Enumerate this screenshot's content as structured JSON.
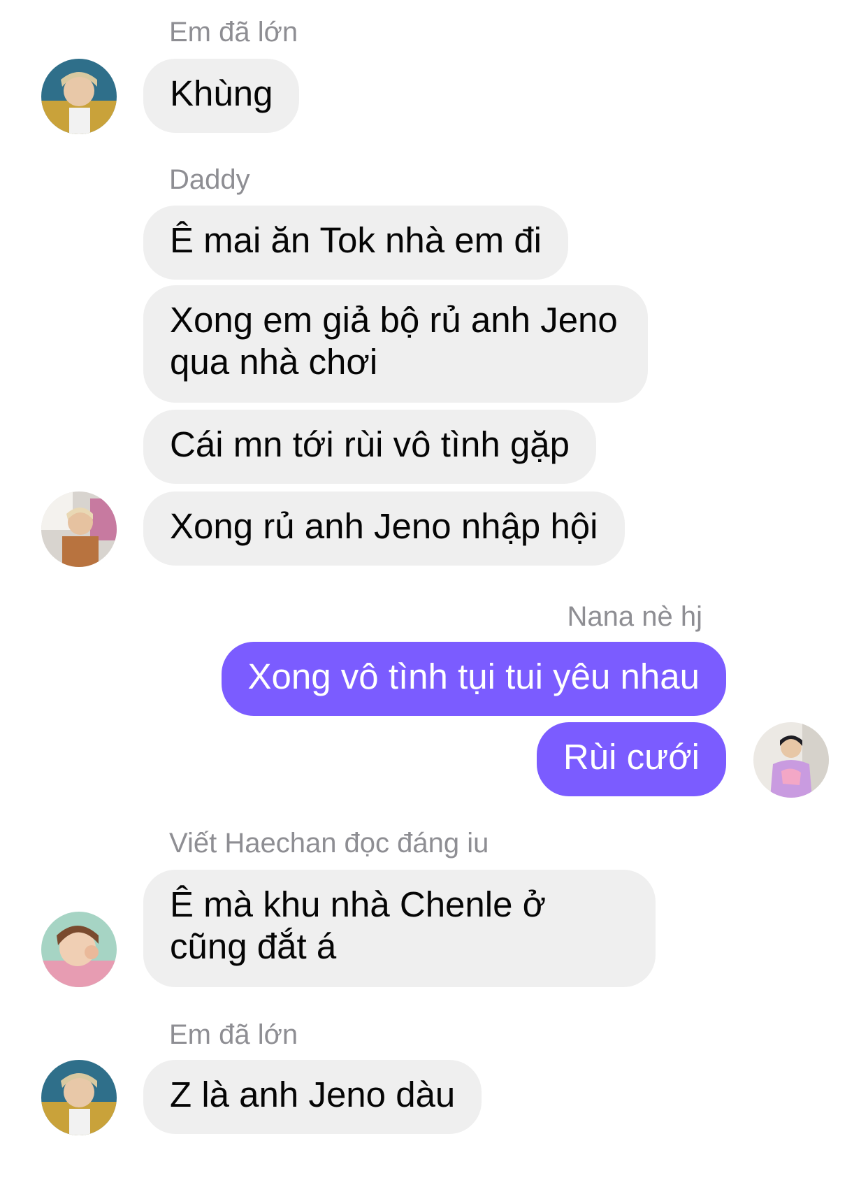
{
  "messages": [
    {
      "sender": "Em đã lớn",
      "bubbles": [
        "Khùng"
      ]
    },
    {
      "sender": "Daddy",
      "bubbles": [
        "Ê mai ăn Tok nhà em đi",
        "Xong em giả bộ rủ anh Jeno qua nhà chơi",
        "Cái mn tới rùi vô tình gặp",
        "Xong rủ anh Jeno nhập hội"
      ]
    },
    {
      "sender": "Nana nè hj",
      "bubbles": [
        "Xong vô tình tụi tui yêu nhau",
        "Rùi cưới"
      ]
    },
    {
      "sender": "Viết Haechan đọc đáng iu",
      "bubbles": [
        "Ê mà khu nhà Chenle ở cũng đắt á"
      ]
    },
    {
      "sender": "Em đã lớn",
      "bubbles": [
        "Z là anh Jeno dàu"
      ]
    }
  ],
  "avatars": {
    "em_da_lon": "avatar-photo",
    "daddy": "avatar-photo",
    "nana": "avatar-photo",
    "haechan": "avatar-photo"
  },
  "colors": {
    "incoming_bubble": "#efefef",
    "outgoing_bubble": "#7b5cff",
    "sender_name": "#8e8e93"
  }
}
